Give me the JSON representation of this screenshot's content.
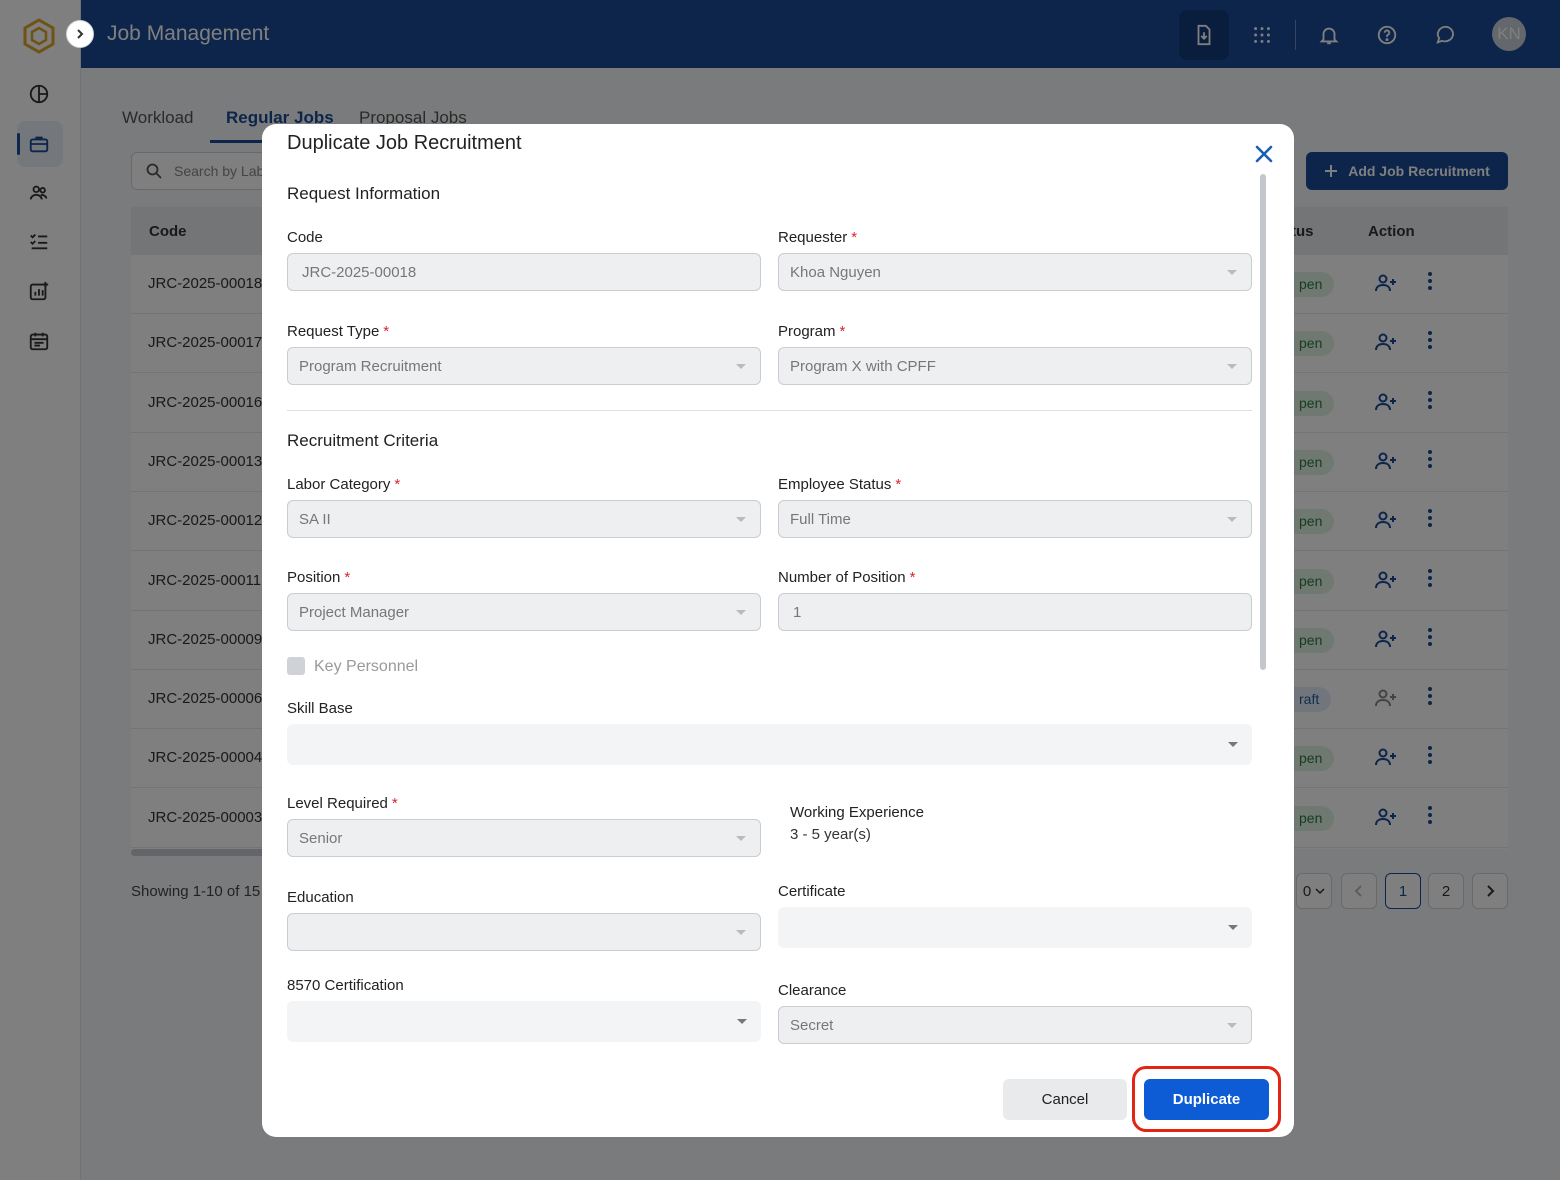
{
  "app": {
    "title": "Job Management",
    "user_initials": "KN",
    "brand_color": "#1a4b96"
  },
  "sidebar": {
    "items": [
      {
        "icon": "dashboard-icon"
      },
      {
        "icon": "briefcase-icon",
        "active": true
      },
      {
        "icon": "users-icon"
      },
      {
        "icon": "checklist-icon"
      },
      {
        "icon": "chart-add-icon"
      },
      {
        "icon": "calendar-icon"
      }
    ]
  },
  "topbar": {
    "icons": [
      "download-doc-icon",
      "apps-grid-icon",
      "bell-icon",
      "help-icon",
      "chat-icon"
    ]
  },
  "page": {
    "tabs": [
      {
        "label": "Workload"
      },
      {
        "label": "Regular Jobs",
        "active": true
      },
      {
        "label": "Proposal Jobs"
      }
    ],
    "search_placeholder": "Search by Lab",
    "add_button": "Add Job Recruitment",
    "columns": {
      "code": "Code",
      "status": "tus",
      "action": "Action"
    },
    "rows": [
      {
        "code": "JRC-2025-00018",
        "status": "pen"
      },
      {
        "code": "JRC-2025-00017",
        "status": "pen"
      },
      {
        "code": "JRC-2025-00016",
        "status": "pen"
      },
      {
        "code": "JRC-2025-00013",
        "status": "pen"
      },
      {
        "code": "JRC-2025-00012",
        "status": "pen"
      },
      {
        "code": "JRC-2025-00011",
        "status": "pen"
      },
      {
        "code": "JRC-2025-00009",
        "status": "pen"
      },
      {
        "code": "JRC-2025-00006",
        "status": "raft"
      },
      {
        "code": "JRC-2025-00004",
        "status": "pen"
      },
      {
        "code": "JRC-2025-00003",
        "status": "pen"
      }
    ],
    "showing": "Showing 1-10 of 15 i",
    "page_size_partial": "0",
    "pages": [
      "1",
      "2"
    ],
    "current_page": "1"
  },
  "modal": {
    "title": "Duplicate Job Recruitment",
    "sections": {
      "request": "Request Information",
      "criteria": "Recruitment Criteria"
    },
    "fields": {
      "code": {
        "label": "Code",
        "value": "JRC-2025-00018"
      },
      "requester": {
        "label": "Requester",
        "value": "Khoa Nguyen"
      },
      "request_type": {
        "label": "Request Type",
        "value": "Program Recruitment"
      },
      "program": {
        "label": "Program",
        "value": "Program X with CPFF"
      },
      "labor_category": {
        "label": "Labor Category",
        "value": "SA II"
      },
      "employee_status": {
        "label": "Employee Status",
        "value": "Full Time"
      },
      "position": {
        "label": "Position",
        "value": "Project Manager"
      },
      "number_of_position": {
        "label": "Number of Position",
        "value": "1"
      },
      "key_personnel": {
        "label": "Key Personnel"
      },
      "skill_base": {
        "label": "Skill Base",
        "value": ""
      },
      "level_required": {
        "label": "Level Required",
        "value": "Senior"
      },
      "working_experience": {
        "label": "Working Experience",
        "value": "3 - 5 year(s)"
      },
      "education": {
        "label": "Education",
        "value": ""
      },
      "certificate": {
        "label": "Certificate",
        "value": ""
      },
      "cert_8570": {
        "label": "8570 Certification",
        "value": ""
      },
      "clearance": {
        "label": "Clearance",
        "value": "Secret"
      }
    },
    "required_marker": "*",
    "buttons": {
      "cancel": "Cancel",
      "duplicate": "Duplicate"
    },
    "highlight_color": "#e32415"
  }
}
